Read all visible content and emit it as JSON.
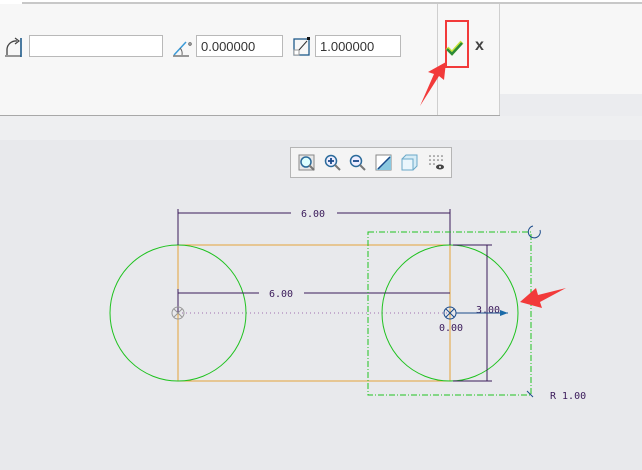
{
  "toolbar": {
    "rotate_field": {
      "icon": "rotate-arc-icon",
      "value": ""
    },
    "angle_field": {
      "icon": "angle-icon",
      "value": "0.000000"
    },
    "scale_field": {
      "icon": "scale-icon",
      "value": "1.000000"
    },
    "confirm": {
      "icon": "checkmark-icon"
    },
    "cancel": {
      "icon": "close-icon",
      "label": "x"
    }
  },
  "view_toolbar": {
    "buttons": [
      "refit-icon",
      "zoom-in-icon",
      "zoom-out-icon",
      "repaint-icon",
      "display-style-icon",
      "sketcher-display-icon"
    ]
  },
  "sketch": {
    "dim_top": "6.00",
    "dim_mid": "6.00",
    "dim_vertical": "3.00",
    "dim_origin": "0.00",
    "scale_label": "R 1.00"
  },
  "colors": {
    "geometry": "#1fc21f",
    "dimension": "#3a1a5a",
    "highlight": "#f23a3a",
    "tangent": "#e3a43a"
  }
}
